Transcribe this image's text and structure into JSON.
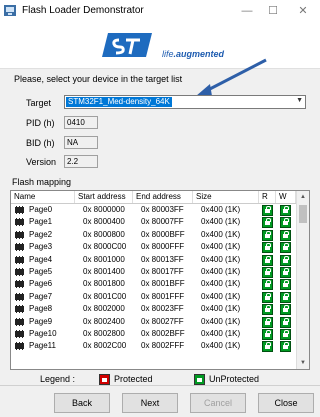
{
  "window": {
    "title": "Flash Loader Demonstrator",
    "minimize": "—",
    "maximize": "☐",
    "close": "✕"
  },
  "banner": {
    "tagline_a": "life",
    "tagline_b": ".augmented"
  },
  "prompt": "Please, select your device in the target list",
  "fields": {
    "target_label": "Target",
    "target_value": "STM32F1_Med-density_64K",
    "pid_label": "PID  (h)",
    "pid_value": "0410",
    "bid_label": "BID  (h)",
    "bid_value": "NA",
    "version_label": "Version",
    "version_value": "2.2"
  },
  "flash_mapping": {
    "title": "Flash mapping",
    "columns": [
      "Name",
      "Start address",
      "End address",
      "Size",
      "R",
      "W"
    ],
    "rows": [
      [
        "Page0",
        "0x 8000000",
        "0x 80003FF",
        "0x400 (1K)"
      ],
      [
        "Page1",
        "0x 8000400",
        "0x 80007FF",
        "0x400 (1K)"
      ],
      [
        "Page2",
        "0x 8000800",
        "0x 8000BFF",
        "0x400 (1K)"
      ],
      [
        "Page3",
        "0x 8000C00",
        "0x 8000FFF",
        "0x400 (1K)"
      ],
      [
        "Page4",
        "0x 8001000",
        "0x 80013FF",
        "0x400 (1K)"
      ],
      [
        "Page5",
        "0x 8001400",
        "0x 80017FF",
        "0x400 (1K)"
      ],
      [
        "Page6",
        "0x 8001800",
        "0x 8001BFF",
        "0x400 (1K)"
      ],
      [
        "Page7",
        "0x 8001C00",
        "0x 8001FFF",
        "0x400 (1K)"
      ],
      [
        "Page8",
        "0x 8002000",
        "0x 80023FF",
        "0x400 (1K)"
      ],
      [
        "Page9",
        "0x 8002400",
        "0x 80027FF",
        "0x400 (1K)"
      ],
      [
        "Page10",
        "0x 8002800",
        "0x 8002BFF",
        "0x400 (1K)"
      ],
      [
        "Page11",
        "0x 8002C00",
        "0x 8002FFF",
        "0x400 (1K)"
      ]
    ]
  },
  "legend": {
    "label": "Legend :",
    "protected": "Protected",
    "unprotected": "UnProtected"
  },
  "buttons": {
    "back": "Back",
    "next": "Next",
    "cancel": "Cancel",
    "close": "Close"
  },
  "colors": {
    "accent": "#0078d7",
    "unprotected": "#009a22",
    "protected": "#d00000",
    "logo": "#1e6bbf"
  }
}
